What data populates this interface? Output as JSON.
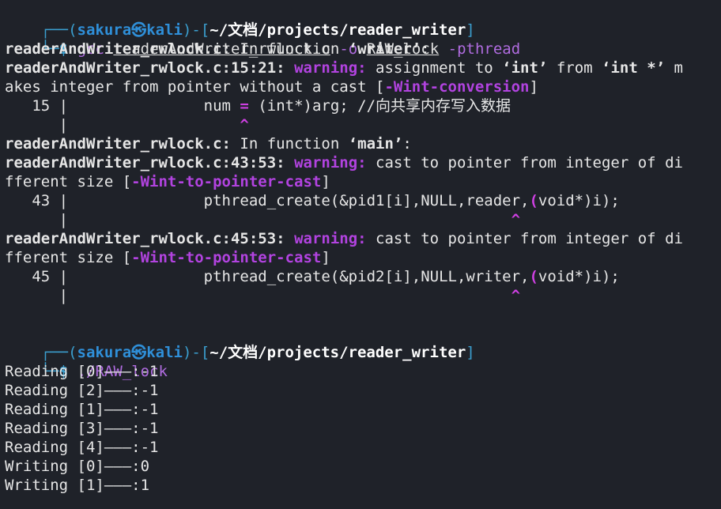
{
  "prompt1": {
    "frame_top": "┌──(",
    "user": "sakura",
    "at_icon": "㉿",
    "host": "kali",
    "sep": ")-[",
    "path": "~/文档/projects/reader_writer",
    "close": "]",
    "frame_bottom": "└─",
    "dollar": "$",
    "cmd": "gcc",
    "arg_file": "readerAndWriter_rwlock.c",
    "flag_o": "-o",
    "arg_out": "RAW_lock",
    "flag_pthread": "-pthread"
  },
  "output": {
    "l1_file": "readerAndWriter_rwlock.c:",
    "l1_rest": " In function ",
    "l1_fn": "‘writer’",
    "l1_end": ":",
    "l2_loc": "readerAndWriter_rwlock.c:15:21:",
    "l2_warn": "warning:",
    "l2_a": " assignment to ",
    "l2_int": "‘int’",
    "l2_b": " from ",
    "l2_intp": "‘int *’",
    "l2_c": " m",
    "l3_a": "akes integer from pointer without a cast [",
    "l3_flag": "-Wint-conversion",
    "l3_b": "]",
    "l4_num": "   15 |",
    "l4_code_a": "               num ",
    "l4_eq": "=",
    "l4_code_b": " (int*)arg; //向共享内存写入数据",
    "l5_gutter": "      |",
    "l5_caret": "                   ^",
    "l6_file": "readerAndWriter_rwlock.c:",
    "l6_rest": " In function ",
    "l6_fn": "‘main’",
    "l6_end": ":",
    "l7_loc": "readerAndWriter_rwlock.c:43:53:",
    "l7_warn": "warning:",
    "l7_rest": " cast to pointer from integer of di",
    "l8_a": "fferent size [",
    "l8_flag": "-Wint-to-pointer-cast",
    "l8_b": "]",
    "l9_num": "   43 |",
    "l9_code_a": "               pthread_create(&pid1[i],NULL,reader,",
    "l9_paren": "(",
    "l9_code_b": "void*)i);",
    "l10_gutter": "      |",
    "l10_caret": "                                                 ^",
    "l11_loc": "readerAndWriter_rwlock.c:45:53:",
    "l11_warn": "warning:",
    "l11_rest": " cast to pointer from integer of di",
    "l12_a": "fferent size [",
    "l12_flag": "-Wint-to-pointer-cast",
    "l12_b": "]",
    "l13_num": "   45 |",
    "l13_code_a": "               pthread_create(&pid2[i],NULL,writer,",
    "l13_paren": "(",
    "l13_code_b": "void*)i);",
    "l14_gutter": "      |",
    "l14_caret": "                                                 ^"
  },
  "prompt2": {
    "frame_top": "┌──(",
    "user": "sakura",
    "at_icon": "㉿",
    "host": "kali",
    "sep": ")-[",
    "path": "~/文档/projects/reader_writer",
    "close": "]",
    "frame_bottom": "└─",
    "dollar": "$",
    "cmd": "./RAW_lock"
  },
  "run_output": [
    "Reading [0]———:-1",
    "Reading [2]———:-1",
    "Reading [1]———:-1",
    "Reading [3]———:-1",
    "Reading [4]———:-1",
    "Writing [0]———:0",
    "Writing [1]———:1"
  ],
  "colors": {
    "background": "#1f2229",
    "prompt_frame": "#3b9fcf",
    "user_host": "#2f8fd8",
    "command": "#b06ce0",
    "warning": "#b243e0"
  }
}
